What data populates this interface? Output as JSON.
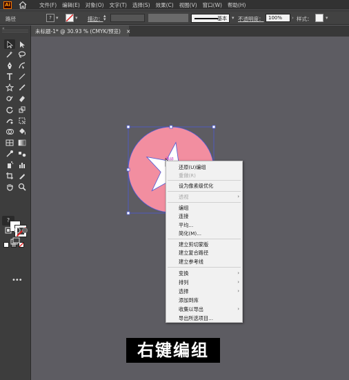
{
  "app": {
    "logo": "Ai"
  },
  "menu": [
    "文件(F)",
    "编辑(E)",
    "对象(O)",
    "文字(T)",
    "选择(S)",
    "效果(C)",
    "视图(V)",
    "窗口(W)",
    "帮助(H)"
  ],
  "control_bar": {
    "selection_label": "路径",
    "stroke_label": "描边：",
    "brush_label": "基本",
    "opacity_label": "不透明度：",
    "opacity_value": "100%",
    "style_label": "样式："
  },
  "document_tab": {
    "title": "未标题-1* @ 30.93 % (CMYK/预览)",
    "close": "×"
  },
  "tools": {
    "fill_stroke_hint": "?",
    "more": "•••"
  },
  "canvas": {
    "circle_color": "#f28ea0",
    "star_color": "#ffffff",
    "selection_color": "#4d5bd6",
    "hover_label": "路径"
  },
  "context_menu": {
    "items": [
      {
        "label": "还原(U)编组",
        "disabled": false,
        "submenu": false
      },
      {
        "label": "重做(R)",
        "disabled": true,
        "submenu": false
      },
      {
        "label": "设为像素级优化",
        "disabled": false,
        "submenu": false
      },
      {
        "label": "透视",
        "disabled": true,
        "submenu": true
      },
      {
        "label": "编组",
        "disabled": false,
        "submenu": false
      },
      {
        "label": "连接",
        "disabled": false,
        "submenu": false
      },
      {
        "label": "平均...",
        "disabled": false,
        "submenu": false
      },
      {
        "label": "简化(M)...",
        "disabled": false,
        "submenu": false
      },
      {
        "label": "建立剪切蒙版",
        "disabled": false,
        "submenu": false
      },
      {
        "label": "建立复合路径",
        "disabled": false,
        "submenu": false
      },
      {
        "label": "建立参考线",
        "disabled": false,
        "submenu": false
      },
      {
        "label": "变换",
        "disabled": false,
        "submenu": true
      },
      {
        "label": "排列",
        "disabled": false,
        "submenu": true
      },
      {
        "label": "选择",
        "disabled": false,
        "submenu": true
      },
      {
        "label": "添加到库",
        "disabled": false,
        "submenu": false
      },
      {
        "label": "收集以导出",
        "disabled": false,
        "submenu": true
      },
      {
        "label": "导出所选项目...",
        "disabled": false,
        "submenu": false
      }
    ]
  },
  "subtitle": "右键编组"
}
